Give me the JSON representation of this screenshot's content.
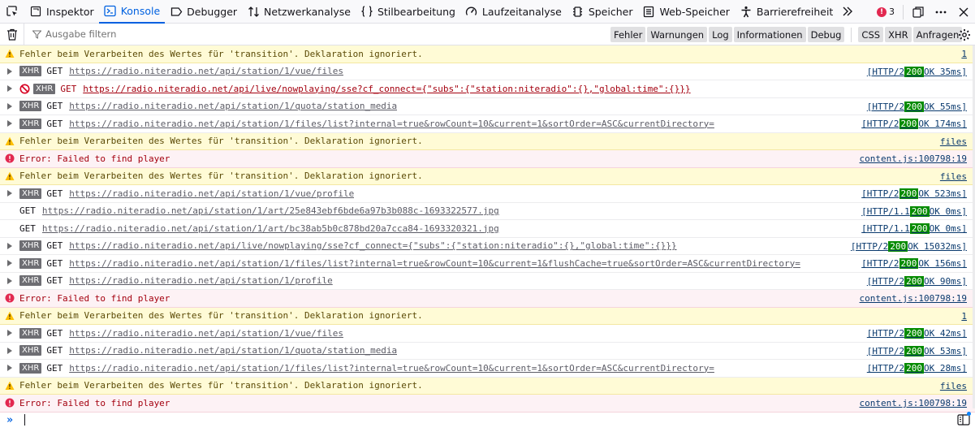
{
  "toolbar": {
    "tabs": [
      {
        "label": "Inspektor",
        "icon": "inspector-icon"
      },
      {
        "label": "Konsole",
        "icon": "console-icon",
        "active": true
      },
      {
        "label": "Debugger",
        "icon": "debugger-icon"
      },
      {
        "label": "Netzwerkanalyse",
        "icon": "network-icon"
      },
      {
        "label": "Stilbearbeitung",
        "icon": "style-editor-icon"
      },
      {
        "label": "Laufzeitanalyse",
        "icon": "performance-icon"
      },
      {
        "label": "Speicher",
        "icon": "memory-icon"
      },
      {
        "label": "Web-Speicher",
        "icon": "storage-icon"
      },
      {
        "label": "Barrierefreiheit",
        "icon": "accessibility-icon"
      }
    ],
    "error_count": "3"
  },
  "filterbar": {
    "placeholder": "Ausgabe filtern",
    "levels": [
      "Fehler",
      "Warnungen",
      "Log",
      "Informationen",
      "Debug"
    ],
    "net_levels": [
      "CSS",
      "XHR",
      "Anfragen"
    ]
  },
  "messages": [
    {
      "type": "warn",
      "text": "Fehler beim Verarbeiten des Wertes für 'transition'.  Deklaration ignoriert.",
      "loc": "1"
    },
    {
      "type": "xhr",
      "method": "GET",
      "url": "https://radio.niteradio.net/api/station/1/vue/files",
      "proto": "[HTTP/2",
      "code": "200",
      "rest": "OK 35ms]"
    },
    {
      "type": "blocked",
      "method": "GET",
      "url": "https://radio.niteradio.net/api/live/nowplaying/sse?cf_connect={\"subs\":{\"station:niteradio\":{},\"global:time\":{}}}"
    },
    {
      "type": "xhr",
      "method": "GET",
      "url": "https://radio.niteradio.net/api/station/1/quota/station_media",
      "proto": "[HTTP/2",
      "code": "200",
      "rest": "OK 55ms]"
    },
    {
      "type": "xhr",
      "method": "GET",
      "url": "https://radio.niteradio.net/api/station/1/files/list?internal=true&rowCount=10&current=1&sortOrder=ASC&currentDirectory=",
      "proto": "[HTTP/2",
      "code": "200",
      "rest": "OK 174ms]"
    },
    {
      "type": "warn",
      "text": "Fehler beim Verarbeiten des Wertes für 'transition'.  Deklaration ignoriert.",
      "loc": "files"
    },
    {
      "type": "error",
      "text": "Error: Failed to find player",
      "loc": "content.js:100798:19"
    },
    {
      "type": "warn",
      "text": "Fehler beim Verarbeiten des Wertes für 'transition'.  Deklaration ignoriert.",
      "loc": "files"
    },
    {
      "type": "xhr",
      "method": "GET",
      "url": "https://radio.niteradio.net/api/station/1/vue/profile",
      "proto": "[HTTP/2",
      "code": "200",
      "rest": "OK 523ms]"
    },
    {
      "type": "get",
      "method": "GET",
      "url": "https://radio.niteradio.net/api/station/1/art/25e843ebf6bde6a97b3b088c-1693322577.jpg",
      "proto": "[HTTP/1.1",
      "code": "200",
      "rest": "OK 0ms]"
    },
    {
      "type": "get",
      "method": "GET",
      "url": "https://radio.niteradio.net/api/station/1/art/bc38ab5b0c878bd20a7cca84-1693320321.jpg",
      "proto": "[HTTP/1.1",
      "code": "200",
      "rest": "OK 0ms]"
    },
    {
      "type": "xhr",
      "method": "GET",
      "url": "https://radio.niteradio.net/api/live/nowplaying/sse?cf_connect={\"subs\":{\"station:niteradio\":{},\"global:time\":{}}}",
      "proto": "[HTTP/2",
      "code": "200",
      "rest": "OK 15032ms]"
    },
    {
      "type": "xhr",
      "method": "GET",
      "url": "https://radio.niteradio.net/api/station/1/files/list?internal=true&rowCount=10&current=1&flushCache=true&sortOrder=ASC&currentDirectory=",
      "proto": "[HTTP/2",
      "code": "200",
      "rest": "OK 156ms]"
    },
    {
      "type": "xhr",
      "method": "GET",
      "url": "https://radio.niteradio.net/api/station/1/profile",
      "proto": "[HTTP/2",
      "code": "200",
      "rest": "OK 90ms]"
    },
    {
      "type": "error",
      "text": "Error: Failed to find player",
      "loc": "content.js:100798:19"
    },
    {
      "type": "warn",
      "text": "Fehler beim Verarbeiten des Wertes für 'transition'.  Deklaration ignoriert.",
      "loc": "1"
    },
    {
      "type": "xhr",
      "method": "GET",
      "url": "https://radio.niteradio.net/api/station/1/vue/files",
      "proto": "[HTTP/2",
      "code": "200",
      "rest": "OK 42ms]"
    },
    {
      "type": "xhr",
      "method": "GET",
      "url": "https://radio.niteradio.net/api/station/1/quota/station_media",
      "proto": "[HTTP/2",
      "code": "200",
      "rest": "OK 53ms]"
    },
    {
      "type": "xhr",
      "method": "GET",
      "url": "https://radio.niteradio.net/api/station/1/files/list?internal=true&rowCount=10&current=1&sortOrder=ASC&currentDirectory=",
      "proto": "[HTTP/2",
      "code": "200",
      "rest": "OK 28ms]"
    },
    {
      "type": "warn",
      "text": "Fehler beim Verarbeiten des Wertes für 'transition'.  Deklaration ignoriert.",
      "loc": "files"
    },
    {
      "type": "error",
      "text": "Error: Failed to find player",
      "loc": "content.js:100798:19"
    }
  ],
  "xhr_tag": "XHR",
  "colors": {
    "accent": "#0061e0",
    "warning_bg": "#fffbd6",
    "error_bg": "#fdf2f5",
    "status_ok": "#058b00"
  }
}
